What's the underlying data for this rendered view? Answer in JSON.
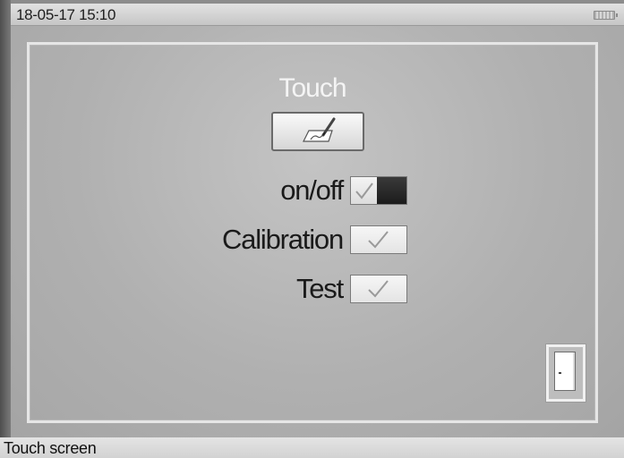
{
  "status_bar": {
    "datetime": "18-05-17 15:10",
    "battery_icon": "battery-icon"
  },
  "page": {
    "title": "Touch",
    "touch_icon": "stylus-touch-icon"
  },
  "settings": [
    {
      "label": "on/off",
      "type": "toggle",
      "checked": true
    },
    {
      "label": "Calibration",
      "type": "checkbox",
      "checked": true
    },
    {
      "label": "Test",
      "type": "checkbox",
      "checked": true
    }
  ],
  "exit_icon": "door-exit-icon",
  "footer": {
    "text": "Touch screen"
  }
}
